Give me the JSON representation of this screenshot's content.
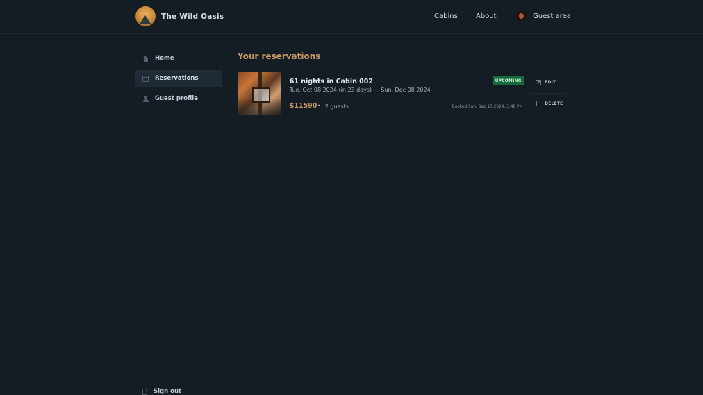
{
  "header": {
    "brand": "The Wild Oasis",
    "nav": {
      "cabins": "Cabins",
      "about": "About",
      "guest_area": "Guest area"
    }
  },
  "sidebar": {
    "items": [
      {
        "label": "Home",
        "icon": "home-icon"
      },
      {
        "label": "Reservations",
        "icon": "calendar-icon",
        "active": true
      },
      {
        "label": "Guest profile",
        "icon": "user-icon"
      }
    ],
    "sign_out": "Sign out"
  },
  "main": {
    "title": "Your reservations",
    "reservations": [
      {
        "title": "61 nights in Cabin 002",
        "dates": "Tue, Oct 08 2024 (in 23 days) — Sun, Dec 08 2024",
        "price": "$11590",
        "separator": "•",
        "guests": "2 guests",
        "status": "UPCOMING",
        "booked": "Booked Sun, Sep 15 2024, 3:48 PM",
        "edit_label": "EDIT",
        "delete_label": "DELETE"
      }
    ]
  },
  "colors": {
    "background": "#141c24",
    "accent": "#c69963",
    "badge": "#176a3d"
  }
}
